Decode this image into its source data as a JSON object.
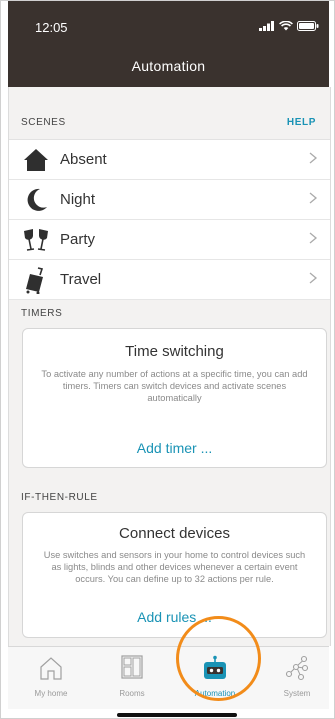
{
  "status_bar": {
    "time": "12:05"
  },
  "header": {
    "title": "Automation"
  },
  "scenes": {
    "section_label": "SCENES",
    "help_label": "HELP",
    "items": [
      {
        "label": "Absent",
        "icon": "house-icon"
      },
      {
        "label": "Night",
        "icon": "moon-icon"
      },
      {
        "label": "Party",
        "icon": "glasses-icon"
      },
      {
        "label": "Travel",
        "icon": "suitcase-icon"
      }
    ]
  },
  "timers": {
    "section_label": "TIMERS",
    "card": {
      "title": "Time switching",
      "description": "To activate any number of actions at a specific time, you can add timers. Timers can switch devices and activate scenes automatically",
      "link": "Add timer ..."
    }
  },
  "rules": {
    "section_label": "IF-THEN-RULE",
    "card": {
      "title": "Connect devices",
      "description": "Use switches and sensors in your home to control devices such as lights, blinds and other devices whenever a certain event occurs. You can define up to 32 actions per rule.",
      "link": "Add rules ..."
    }
  },
  "tabbar": {
    "tabs": [
      {
        "label": "My home",
        "icon": "home-outline-icon",
        "active": false
      },
      {
        "label": "Rooms",
        "icon": "rooms-icon",
        "active": false
      },
      {
        "label": "Automation",
        "icon": "robot-icon",
        "active": true
      },
      {
        "label": "System",
        "icon": "network-icon",
        "active": false
      }
    ]
  },
  "colors": {
    "header_bg": "#3a322e",
    "accent": "#1a93b5",
    "highlight": "#f28c1a"
  }
}
